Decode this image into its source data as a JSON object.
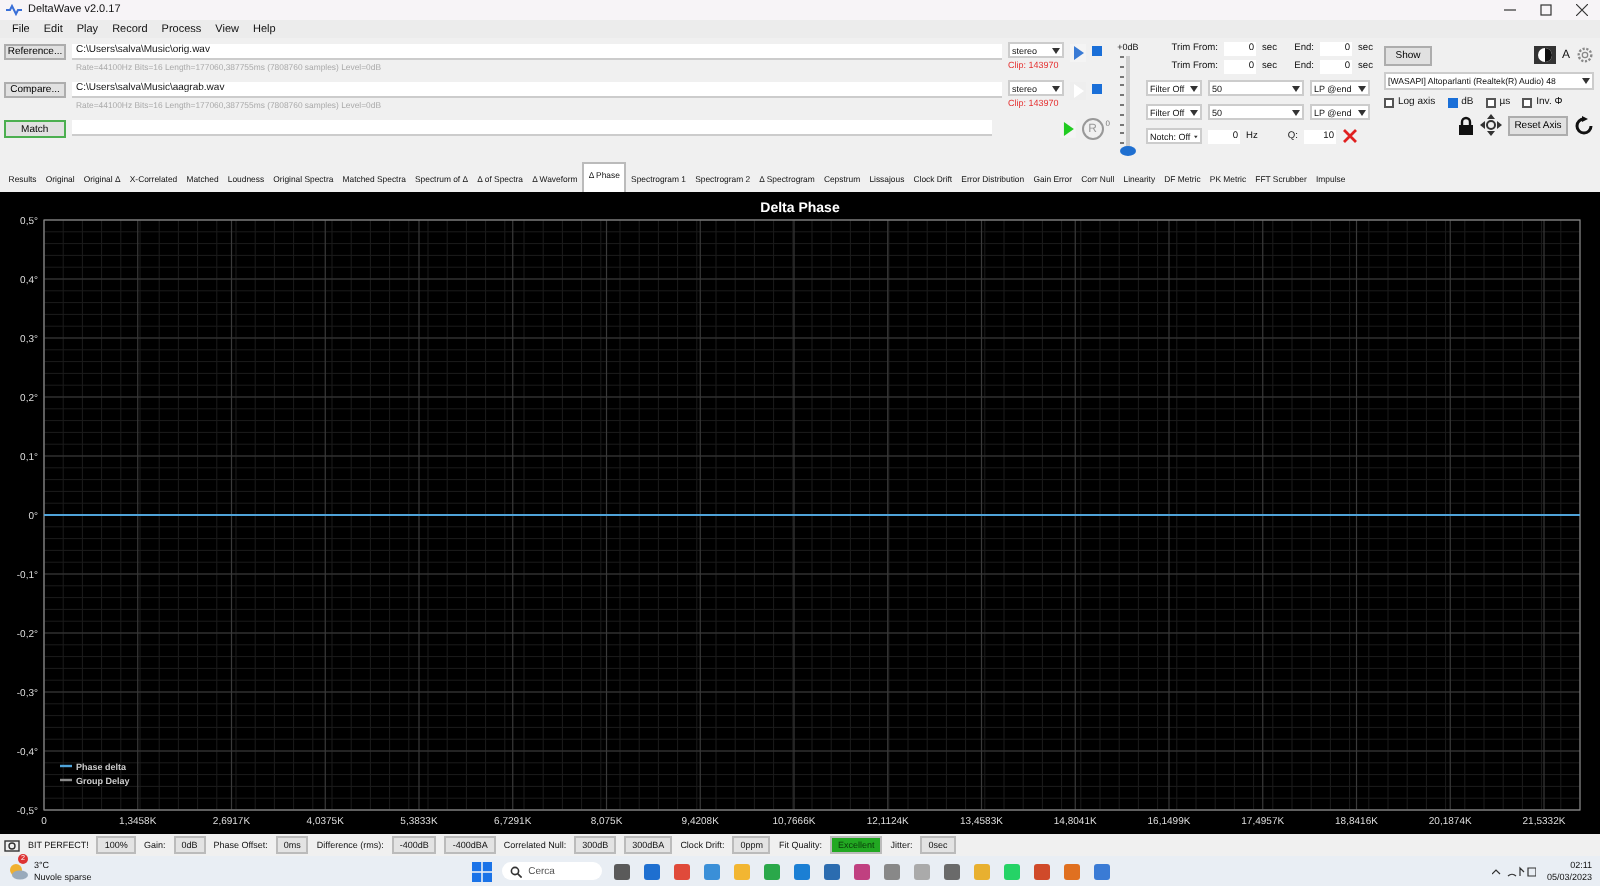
{
  "window": {
    "title": "DeltaWave v2.0.17"
  },
  "menu": [
    "File",
    "Edit",
    "Play",
    "Record",
    "Process",
    "View",
    "Help"
  ],
  "tracks": [
    {
      "kind": "file",
      "button": "Reference...",
      "path": "C:\\Users\\salva\\Music\\orig.wav",
      "info": "Rate=44100Hz Bits=16 Length=177060,387755ms (7808760 samples) Level=0dB",
      "channel": "stereo",
      "clip": "Clip: 143970",
      "play_enabled": true,
      "checked": true
    },
    {
      "kind": "file",
      "button": "Compare...",
      "path": "C:\\Users\\salva\\Music\\aagrab.wav",
      "info": "Rate=44100Hz Bits=16 Length=177060,387755ms (7808760 samples) Level=0dB",
      "channel": "stereo",
      "clip": "Clip: 143970",
      "play_enabled": false,
      "checked": true
    },
    {
      "kind": "match",
      "button": "Match",
      "play_enabled": true,
      "realign": "R",
      "badge": "0"
    }
  ],
  "gain_slider": {
    "label": "+0dB",
    "level": 0
  },
  "trim": [
    {
      "label": "Trim From:",
      "value": "0",
      "unit": "sec",
      "end_label": "End:",
      "end_value": "0",
      "end_unit": "sec"
    },
    {
      "label": "Trim From:",
      "value": "0",
      "unit": "sec",
      "end_label": "End:",
      "end_value": "0",
      "end_unit": "sec"
    }
  ],
  "filters": [
    {
      "type": "Filter Off",
      "value": "50",
      "mode": "LP @end"
    },
    {
      "type": "Filter Off",
      "value": "50",
      "mode": "LP @end"
    }
  ],
  "notch": {
    "type": "Notch: Off",
    "value": "0",
    "unit": "Hz",
    "q_label": "Q:",
    "q_value": "10"
  },
  "show_button": "Show",
  "font_label": "A",
  "device": "[WASAPI] Altoparlanti (Realtek(R) Audio) 48",
  "options": [
    {
      "label": "Log axis",
      "checked": false
    },
    {
      "label": "dB",
      "checked": true
    },
    {
      "label": "µs",
      "checked": false
    },
    {
      "label": "Inv. Φ",
      "checked": false
    }
  ],
  "reset_button": "Reset Axis",
  "tabs": [
    {
      "label": "Results",
      "selected": false
    },
    {
      "label": "Original",
      "selected": false
    },
    {
      "label": "Original Δ",
      "selected": false
    },
    {
      "label": "X-Correlated",
      "selected": false
    },
    {
      "label": "Matched",
      "selected": false
    },
    {
      "label": "Loudness",
      "selected": false
    },
    {
      "label": "Original Spectra",
      "selected": false
    },
    {
      "label": "Matched Spectra",
      "selected": false
    },
    {
      "label": "Spectrum of Δ",
      "selected": false
    },
    {
      "label": "Δ of Spectra",
      "selected": false
    },
    {
      "label": "Δ Waveform",
      "selected": false
    },
    {
      "label": "Δ Phase",
      "selected": true
    },
    {
      "label": "Spectrogram 1",
      "selected": false
    },
    {
      "label": "Spectrogram 2",
      "selected": false
    },
    {
      "label": "Δ Spectrogram",
      "selected": false
    },
    {
      "label": "Cepstrum",
      "selected": false
    },
    {
      "label": "Lissajous",
      "selected": false
    },
    {
      "label": "Clock Drift",
      "selected": false
    },
    {
      "label": "Error Distribution",
      "selected": false
    },
    {
      "label": "Gain Error",
      "selected": false
    },
    {
      "label": "Corr Null",
      "selected": false
    },
    {
      "label": "Linearity",
      "selected": false
    },
    {
      "label": "DF Metric",
      "selected": false
    },
    {
      "label": "PK Metric",
      "selected": false
    },
    {
      "label": "FFT Scrubber",
      "selected": false
    },
    {
      "label": "Impulse",
      "selected": false
    }
  ],
  "chart": {
    "chart_data": {
      "type": "line",
      "title": "Delta Phase",
      "x": [
        0,
        22050
      ],
      "series": [
        {
          "name": "Phase delta",
          "color": "#4fa3d9",
          "values": [
            0,
            0
          ]
        },
        {
          "name": "Group Delay",
          "color": "#8a8a8a",
          "values": [
            null,
            null
          ]
        }
      ],
      "xlim": [
        0,
        22050
      ],
      "ylim": [
        -0.5,
        0.5
      ],
      "grid": true,
      "xticks": [
        {
          "value": 0,
          "label": "0"
        },
        {
          "value": 1345.8,
          "label": "1,3458K"
        },
        {
          "value": 2691.7,
          "label": "2,6917K"
        },
        {
          "value": 4037.5,
          "label": "4,0375K"
        },
        {
          "value": 5383.3,
          "label": "5,3833K"
        },
        {
          "value": 6729.1,
          "label": "6,7291K"
        },
        {
          "value": 8075,
          "label": "8,075K"
        },
        {
          "value": 9420.8,
          "label": "9,4208K"
        },
        {
          "value": 10766.6,
          "label": "10,7666K"
        },
        {
          "value": 12112.4,
          "label": "12,1124K"
        },
        {
          "value": 13458.3,
          "label": "13,4583K"
        },
        {
          "value": 14804.1,
          "label": "14,8041K"
        },
        {
          "value": 16149.9,
          "label": "16,1499K"
        },
        {
          "value": 17495.7,
          "label": "17,4957K"
        },
        {
          "value": 18841.6,
          "label": "18,8416K"
        },
        {
          "value": 20187.4,
          "label": "20,1874K"
        },
        {
          "value": 21533.2,
          "label": "21,5332K"
        }
      ],
      "yticks": [
        {
          "value": 0.5,
          "label": "0,5°"
        },
        {
          "value": 0.4,
          "label": "0,4°"
        },
        {
          "value": 0.3,
          "label": "0,3°"
        },
        {
          "value": 0.2,
          "label": "0,2°"
        },
        {
          "value": 0.1,
          "label": "0,1°"
        },
        {
          "value": 0,
          "label": "0°"
        },
        {
          "value": -0.1,
          "label": "-0,1°"
        },
        {
          "value": -0.2,
          "label": "-0,2°"
        },
        {
          "value": -0.3,
          "label": "-0,3°"
        },
        {
          "value": -0.4,
          "label": "-0,4°"
        },
        {
          "value": -0.5,
          "label": "-0,5°"
        }
      ]
    }
  },
  "status_bar": [
    {
      "kind": "label",
      "text": "BIT PERFECT!"
    },
    {
      "kind": "value",
      "text": "100%"
    },
    {
      "kind": "label",
      "text": "Gain:"
    },
    {
      "kind": "value",
      "text": "0dB"
    },
    {
      "kind": "label",
      "text": "Phase Offset:"
    },
    {
      "kind": "value",
      "text": "0ms"
    },
    {
      "kind": "label",
      "text": "Difference (rms):"
    },
    {
      "kind": "value",
      "text": "-400dB"
    },
    {
      "kind": "value",
      "text": "-400dBA"
    },
    {
      "kind": "label",
      "text": "Correlated Null:"
    },
    {
      "kind": "value",
      "text": "300dB"
    },
    {
      "kind": "value",
      "text": "300dBA"
    },
    {
      "kind": "label",
      "text": "Clock Drift:"
    },
    {
      "kind": "value",
      "text": "0ppm"
    },
    {
      "kind": "label",
      "text": "Fit Quality:"
    },
    {
      "kind": "good",
      "text": "Excellent"
    },
    {
      "kind": "label",
      "text": "Jitter:"
    },
    {
      "kind": "value",
      "text": "0sec"
    }
  ],
  "taskbar": {
    "weather_badge": "2",
    "temperature": "3°C",
    "weather": "Nuvole sparse",
    "search_placeholder": "Cerca",
    "time": "02:11",
    "date": "05/03/2023"
  }
}
